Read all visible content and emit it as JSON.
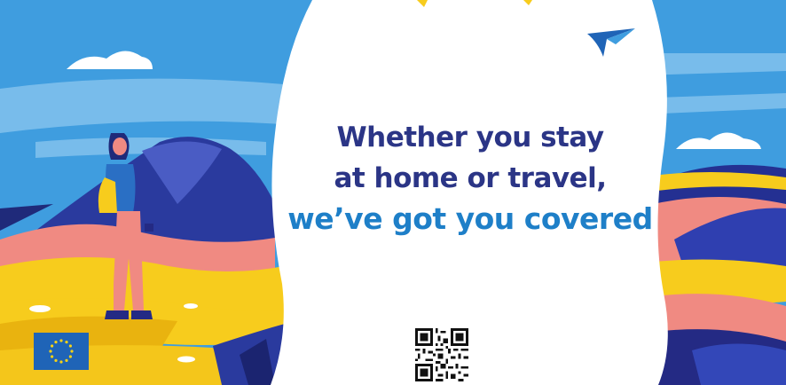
{
  "headline": {
    "line1": "Whether you stay",
    "line2": "at home or travel,",
    "line3": "we’ve got you covered"
  },
  "colors": {
    "sky": "#3f9ddf",
    "headline_dark": "#2b3586",
    "headline_accent": "#1e7fc8",
    "yellow": "#f7cc1d",
    "pink": "#f08a82",
    "navy": "#242a84",
    "eu_blue": "#1f64b7",
    "eu_star": "#f7d216"
  },
  "icons": {
    "logo": "bird-logo-icon",
    "flag": "eu-flag-icon",
    "qr": "qr-code-icon"
  }
}
